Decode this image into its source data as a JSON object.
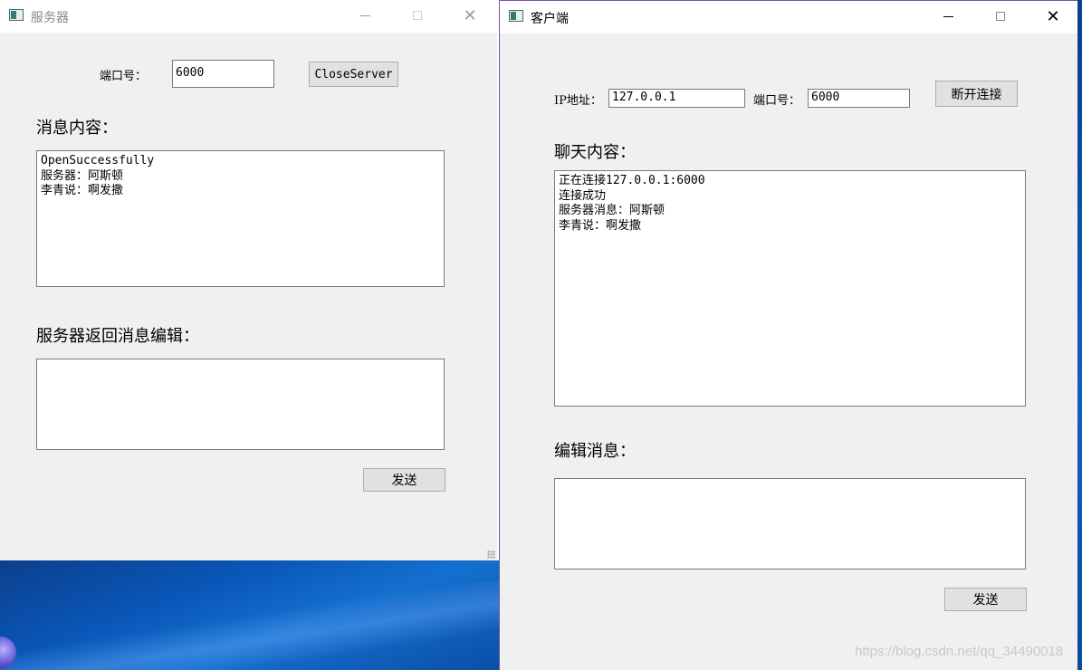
{
  "server_window": {
    "title": "服务器",
    "port_label": "端口号：",
    "port_value": "6000",
    "close_button": "CloseServer",
    "messages_label": "消息内容：",
    "messages": [
      "OpenSuccessfully",
      "服务器：阿斯顿",
      "李青说：啊发撒"
    ],
    "reply_label": "服务器返回消息编辑：",
    "reply_value": "",
    "send_button": "发送"
  },
  "client_window": {
    "title": "客户端",
    "ip_label": "IP地址：",
    "ip_value": "127.0.0.1",
    "port_label": "端口号：",
    "port_value": "6000",
    "disconnect_button": "断开连接",
    "chat_label": "聊天内容：",
    "chat_lines": [
      "正在连接127.0.0.1:6000",
      "连接成功",
      "服务器消息：阿斯顿",
      "李青说：啊发撒"
    ],
    "edit_label": "编辑消息：",
    "edit_value": "",
    "send_button": "发送"
  },
  "icons": {
    "minimize": "minimize-icon",
    "maximize": "maximize-icon",
    "close": "close-icon",
    "app": "app-window-icon"
  },
  "watermark": "https://blog.csdn.net/qq_34490018"
}
